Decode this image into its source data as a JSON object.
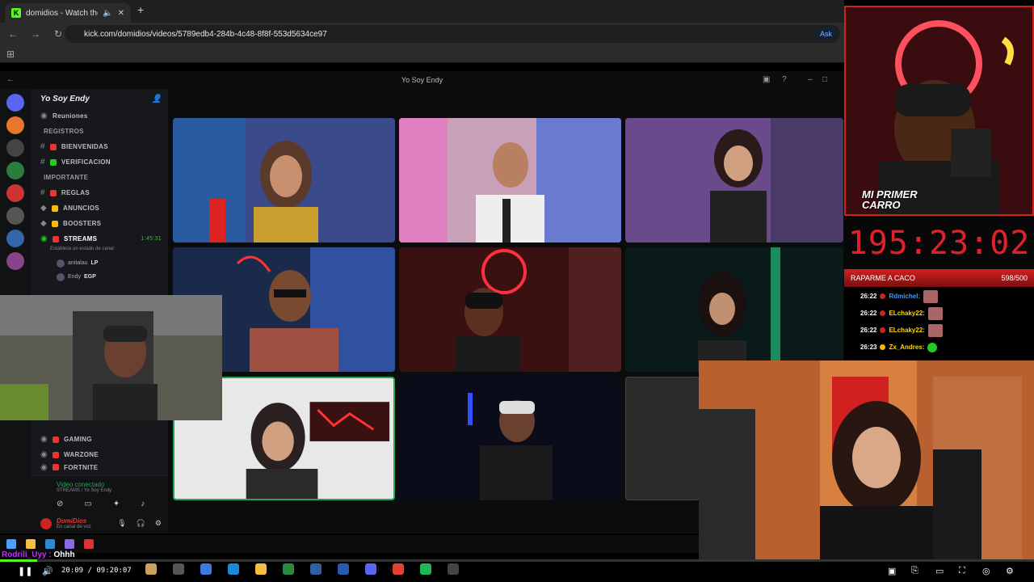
{
  "browser": {
    "tab_title": "domidios - Watch the VOD",
    "url": "kick.com/domidios/videos/5789edb4-284b-4c48-8f8f-553d5634ce97",
    "ask_label": "Ask"
  },
  "discord": {
    "window_title": "Yo Soy Endy",
    "guild_name": "Yo Soy Endy",
    "channels": [
      {
        "label": "Reuniones"
      },
      {
        "label": "REGISTROS"
      },
      {
        "label": "BIENVENIDAS"
      },
      {
        "label": "VERIFICACION"
      },
      {
        "label": "IMPORTANTE"
      },
      {
        "label": "REGLAS"
      },
      {
        "label": "ANUNCIOS"
      },
      {
        "label": "BOOSTERS"
      },
      {
        "label": "STREAMS",
        "time": "1:45:31"
      }
    ],
    "stream_sub": "Establece un estado de canal",
    "voice_users": [
      {
        "name": "anitalau",
        "tag": "LP"
      },
      {
        "name": "Endy",
        "tag": "EGP"
      }
    ],
    "lower_channels": [
      "GAMING",
      "WARZONE",
      "FORTNITE"
    ],
    "voice_connected": "Video conectado",
    "voice_channel": "STREAMS / Yo Soy Endy",
    "user_name": "DomiDios",
    "user_status": "En canal de voz"
  },
  "stream": {
    "timer": "195:23:02",
    "goal_label": "RAPARME A CACO",
    "goal_count": "598/500",
    "chat": [
      {
        "time": "26:22",
        "user": "Rdmichel:",
        "color": "#3b9cff"
      },
      {
        "time": "26:22",
        "user": "ELchaky22:",
        "color": "#ffd700"
      },
      {
        "time": "26:22",
        "user": "ELchaky22:",
        "color": "#ffd700"
      },
      {
        "time": "26:23",
        "user": "Zx_Andres:",
        "color": "#ffd700"
      }
    ],
    "cam_caption": "MI PRIMER CARRO",
    "bottom_chat_user": "Rodrili_Uyy :",
    "bottom_chat_msg": "Ohhh",
    "time_current": "20:09",
    "time_total": "09:20:07",
    "progress": 0.036
  },
  "colors": {
    "kick_green": "#53fc18",
    "timer_red": "#e0202a",
    "discord_green": "#23a55a"
  }
}
